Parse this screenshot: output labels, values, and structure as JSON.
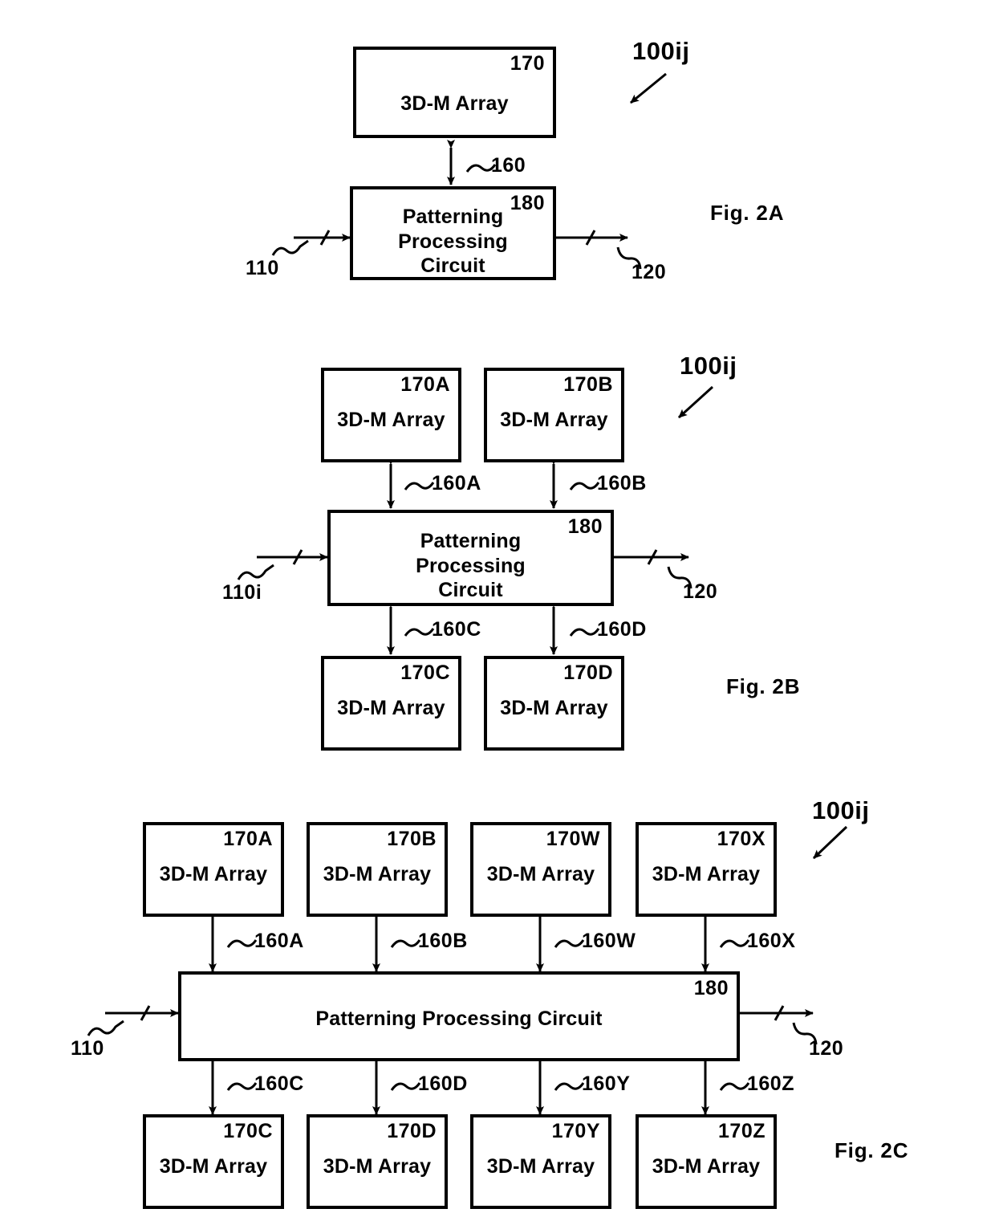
{
  "figure_set": {
    "title": "3D-M Array and Patterning Processing Circuit block diagrams",
    "line_color": "#000000",
    "fill_color": "#ffffff"
  },
  "fig2a": {
    "label": "Fig. 2A",
    "tag": "100ij",
    "array": {
      "num": "170",
      "name": "3D-M Array"
    },
    "circuit": {
      "num": "180",
      "name_line1": "Patterning",
      "name_line2": "Processing",
      "name_line3": "Circuit"
    },
    "link": "160",
    "input": "110",
    "output": "120"
  },
  "fig2b": {
    "label": "Fig. 2B",
    "tag": "100ij",
    "arrays_top": [
      {
        "num": "170A",
        "name": "3D-M Array"
      },
      {
        "num": "170B",
        "name": "3D-M Array"
      }
    ],
    "arrays_bottom": [
      {
        "num": "170C",
        "name": "3D-M Array"
      },
      {
        "num": "170D",
        "name": "3D-M Array"
      }
    ],
    "circuit": {
      "num": "180",
      "name_line1": "Patterning",
      "name_line2": "Processing",
      "name_line3": "Circuit"
    },
    "links_top": [
      "160A",
      "160B"
    ],
    "links_bottom": [
      "160C",
      "160D"
    ],
    "input": "110i",
    "output": "120"
  },
  "fig2c": {
    "label": "Fig. 2C",
    "tag": "100ij",
    "arrays_top": [
      {
        "num": "170A",
        "name": "3D-M Array"
      },
      {
        "num": "170B",
        "name": "3D-M Array"
      },
      {
        "num": "170W",
        "name": "3D-M Array"
      },
      {
        "num": "170X",
        "name": "3D-M Array"
      }
    ],
    "arrays_bottom": [
      {
        "num": "170C",
        "name": "3D-M Array"
      },
      {
        "num": "170D",
        "name": "3D-M Array"
      },
      {
        "num": "170Y",
        "name": "3D-M Array"
      },
      {
        "num": "170Z",
        "name": "3D-M Array"
      }
    ],
    "circuit": {
      "num": "180",
      "name": "Patterning Processing Circuit"
    },
    "links_top": [
      "160A",
      "160B",
      "160W",
      "160X"
    ],
    "links_bottom": [
      "160C",
      "160D",
      "160Y",
      "160Z"
    ],
    "input": "110",
    "output": "120"
  }
}
